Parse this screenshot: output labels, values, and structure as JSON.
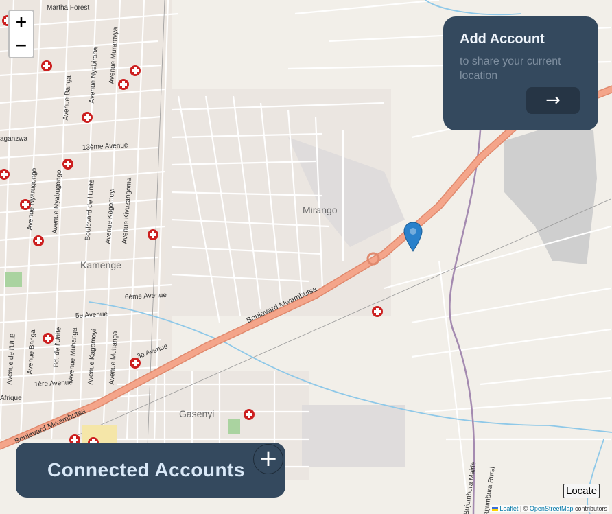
{
  "map": {
    "places": [
      {
        "name": "Mirango"
      },
      {
        "name": "Kamenge"
      },
      {
        "name": "Gasenyi"
      }
    ],
    "roads": [
      {
        "name": "Boulevard Mwambutsa"
      },
      {
        "name": "Boulevard Mwambutsa"
      },
      {
        "name": "Martha Forest"
      },
      {
        "name": "6ème Avenue"
      },
      {
        "name": "3e Avenue"
      },
      {
        "name": "5e Avenue"
      },
      {
        "name": "1ère Avenue"
      },
      {
        "name": "13ème Avenue"
      },
      {
        "name": "Avenue Banga"
      },
      {
        "name": "Avenue Nyabiraba"
      },
      {
        "name": "Avenue Muramvya"
      },
      {
        "name": "Boulevard de l'Unité"
      },
      {
        "name": "Avenue Kagomoyi"
      },
      {
        "name": "Avenue Kivuzangoma"
      },
      {
        "name": "Avenue Muhanga"
      },
      {
        "name": "Avenue Nyabugongo"
      },
      {
        "name": "Avenue Kagomoyi"
      },
      {
        "name": "Avenue Muhanga"
      },
      {
        "name": "Bd. de l'Unité"
      },
      {
        "name": "Avenue Banga"
      },
      {
        "name": "Avenue de l'UEB"
      },
      {
        "name": "Avenue Nyarugongo"
      },
      {
        "name": "Afrique"
      },
      {
        "name": "Bujumbura Mairie"
      },
      {
        "name": "Bujumbura Rural"
      },
      {
        "name": "aganzwa"
      }
    ],
    "marker": {
      "color": "#2a81cb"
    }
  },
  "zoom": {
    "in_label": "+",
    "out_label": "−"
  },
  "add_account": {
    "title": "Add Account",
    "subtitle": "to share your current location",
    "arrow_icon": "→"
  },
  "connected_accounts": {
    "label": "Connected Accounts",
    "add_icon": "+"
  },
  "locate_button": "Locate",
  "attribution": {
    "leaflet": "Leaflet",
    "sep": " | © ",
    "osm": "OpenStreetMap",
    "suffix": " contributors"
  },
  "colors": {
    "card": "#34495e",
    "boulevard": "#f4a58a",
    "water": "#8ec8e8",
    "poi": "#cc1f1f"
  }
}
